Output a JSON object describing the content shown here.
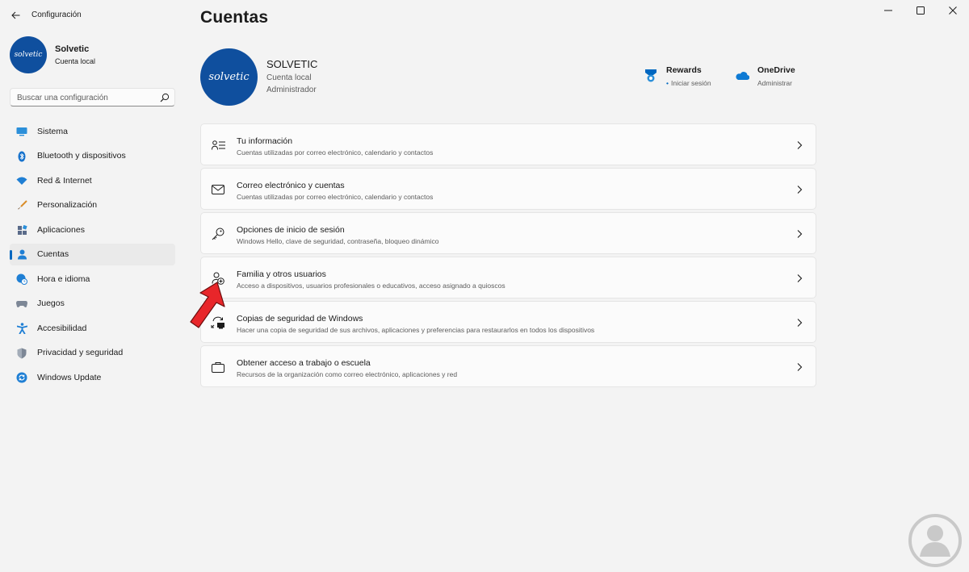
{
  "titlebar": {
    "app_title": "Configuración"
  },
  "profile": {
    "name": "Solvetic",
    "account_type": "Cuenta local",
    "avatar_text": "solvetic"
  },
  "search": {
    "placeholder": "Buscar una configuración"
  },
  "nav": {
    "items": [
      {
        "label": "Sistema",
        "icon": "monitor-icon"
      },
      {
        "label": "Bluetooth y dispositivos",
        "icon": "bluetooth-icon"
      },
      {
        "label": "Red & Internet",
        "icon": "wifi-icon"
      },
      {
        "label": "Personalización",
        "icon": "brush-icon"
      },
      {
        "label": "Aplicaciones",
        "icon": "apps-icon"
      },
      {
        "label": "Cuentas",
        "icon": "person-icon",
        "active": true
      },
      {
        "label": "Hora e idioma",
        "icon": "globe-clock-icon"
      },
      {
        "label": "Juegos",
        "icon": "gamepad-icon"
      },
      {
        "label": "Accesibilidad",
        "icon": "accessibility-icon"
      },
      {
        "label": "Privacidad y seguridad",
        "icon": "shield-icon"
      },
      {
        "label": "Windows Update",
        "icon": "update-icon"
      }
    ]
  },
  "main": {
    "title": "Cuentas",
    "account": {
      "name": "SOLVETIC",
      "type": "Cuenta local",
      "role": "Administrador",
      "avatar_text": "solvetic"
    },
    "services": [
      {
        "title": "Rewards",
        "subtitle": "Iniciar sesión",
        "icon": "rewards-icon"
      },
      {
        "title": "OneDrive",
        "subtitle": "Administrar",
        "icon": "onedrive-icon"
      }
    ],
    "cards": [
      {
        "title": "Tu información",
        "subtitle": "Cuentas utilizadas por correo electrónico, calendario y contactos",
        "icon": "person-card-icon"
      },
      {
        "title": "Correo electrónico y cuentas",
        "subtitle": "Cuentas utilizadas por correo electrónico, calendario y contactos",
        "icon": "mail-icon"
      },
      {
        "title": "Opciones de inicio de sesión",
        "subtitle": "Windows Hello, clave de seguridad, contraseña, bloqueo dinámico",
        "icon": "key-icon"
      },
      {
        "title": "Familia y otros usuarios",
        "subtitle": "Acceso a dispositivos, usuarios profesionales o educativos, acceso asignado a quioscos",
        "icon": "person-add-icon"
      },
      {
        "title": "Copias de seguridad de Windows",
        "subtitle": "Hacer una copia de seguridad de sus archivos, aplicaciones y preferencias para restaurarlos en todos los dispositivos",
        "icon": "backup-icon"
      },
      {
        "title": "Obtener acceso a trabajo o escuela",
        "subtitle": "Recursos de la organización como correo electrónico, aplicaciones y red",
        "icon": "briefcase-icon"
      }
    ]
  },
  "colors": {
    "accent": "#0067c0",
    "avatar_bg": "#0f4f9e",
    "arrow": "#e8262a"
  }
}
